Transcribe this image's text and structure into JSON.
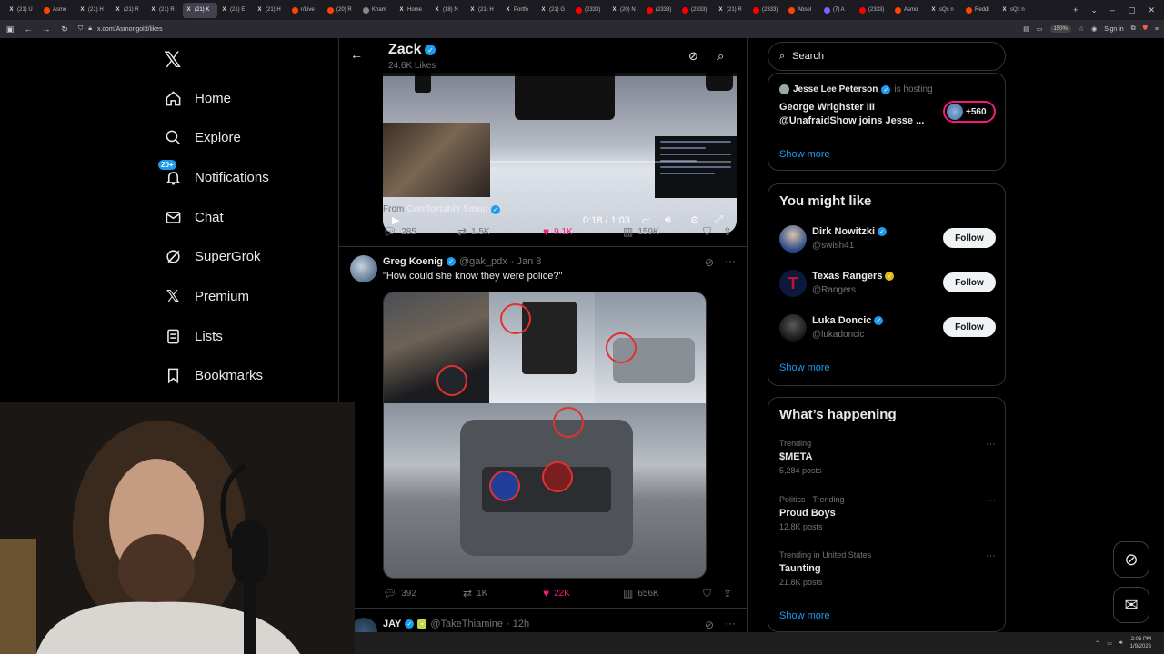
{
  "browser": {
    "tabs": [
      {
        "label": "(21) U",
        "favicon": "x"
      },
      {
        "label": "Asmo",
        "favicon": "r"
      },
      {
        "label": "(21) H",
        "favicon": "x"
      },
      {
        "label": "(21) R",
        "favicon": "x"
      },
      {
        "label": "(21) R",
        "favicon": "x"
      },
      {
        "label": "(21) K",
        "favicon": "x",
        "active": true
      },
      {
        "label": "(21) E",
        "favicon": "x"
      },
      {
        "label": "(21) H",
        "favicon": "x"
      },
      {
        "label": "r/Live",
        "favicon": "r"
      },
      {
        "label": "(20) R",
        "favicon": "r"
      },
      {
        "label": "Kham",
        "favicon": "g"
      },
      {
        "label": "Home",
        "favicon": "x"
      },
      {
        "label": "(18) N",
        "favicon": "x"
      },
      {
        "label": "(21) H",
        "favicon": "x"
      },
      {
        "label": "Portfo",
        "favicon": "x"
      },
      {
        "label": "(21) G",
        "favicon": "x"
      },
      {
        "label": "(2333)",
        "favicon": "y"
      },
      {
        "label": "(20) N",
        "favicon": "x"
      },
      {
        "label": "(2333)",
        "favicon": "y"
      },
      {
        "label": "(2333)",
        "favicon": "y"
      },
      {
        "label": "(21) R",
        "favicon": "x"
      },
      {
        "label": "(2333)",
        "favicon": "y"
      },
      {
        "label": "Absol",
        "favicon": "r"
      },
      {
        "label": "(7) A",
        "favicon": "p"
      },
      {
        "label": "(2333)",
        "favicon": "y"
      },
      {
        "label": "Asmo",
        "favicon": "r"
      },
      {
        "label": "sQc n",
        "favicon": "x"
      },
      {
        "label": "Reddi",
        "favicon": "r"
      },
      {
        "label": "sQc n",
        "favicon": "x"
      }
    ],
    "url": "x.com/Asmongold/likes",
    "zoom": "150%",
    "sign_in": "Sign in"
  },
  "nav": {
    "items": [
      {
        "label": "Home",
        "icon": "home-icon"
      },
      {
        "label": "Explore",
        "icon": "search-icon"
      },
      {
        "label": "Notifications",
        "icon": "bell-icon",
        "badge": "20+"
      },
      {
        "label": "Chat",
        "icon": "mail-icon"
      },
      {
        "label": "SuperGrok",
        "icon": "grok-icon"
      },
      {
        "label": "Premium",
        "icon": "x-icon"
      },
      {
        "label": "Lists",
        "icon": "list-icon"
      },
      {
        "label": "Bookmarks",
        "icon": "bookmark-icon"
      }
    ]
  },
  "header": {
    "name": "Zack",
    "likes": "24.6K Likes"
  },
  "video_post": {
    "time": "0:18 / 1:03",
    "progress": 0.29,
    "from_prefix": "From",
    "from_account": "Comfortably Smug",
    "replies": "285",
    "reposts": "1.5K",
    "likes": "9.1K",
    "views": "159K"
  },
  "tweet": {
    "name": "Greg Koenig",
    "handle": "@gak_pdx",
    "date": "· Jan 8",
    "text": "\"How could she know they were police?\"",
    "replies": "392",
    "reposts": "1K",
    "likes": "22K",
    "views": "656K"
  },
  "next_tweet": {
    "name": "JAY",
    "handle": "@TakeThiamine",
    "date": "· 12h"
  },
  "right": {
    "search_placeholder": "Search",
    "spaces": {
      "host": "Jesse Lee Peterson",
      "host_suffix": "is hosting",
      "title": "George Wrighster III @UnafraidShow joins Jesse ...",
      "listeners": "+560",
      "show_more": "Show more"
    },
    "you_might_like": {
      "title": "You might like",
      "accounts": [
        {
          "name": "Dirk Nowitzki",
          "handle": "@swish41",
          "badge": "blue",
          "button": "Follow"
        },
        {
          "name": "Texas Rangers",
          "handle": "@Rangers",
          "badge": "gold",
          "button": "Follow"
        },
        {
          "name": "Luka Doncic",
          "handle": "@lukadoncic",
          "badge": "blue",
          "button": "Follow"
        }
      ],
      "show_more": "Show more"
    },
    "happening": {
      "title": "What’s happening",
      "trends": [
        {
          "meta": "Trending",
          "name": "$META",
          "count": "5,284 posts"
        },
        {
          "meta": "Politics · Trending",
          "name": "Proud Boys",
          "count": "12.8K posts"
        },
        {
          "meta": "Trending in United States",
          "name": "Taunting",
          "count": "21.8K posts"
        }
      ],
      "show_more": "Show more"
    }
  },
  "taskbar": {
    "time": "2:06 PM",
    "date": "1/9/2026"
  }
}
